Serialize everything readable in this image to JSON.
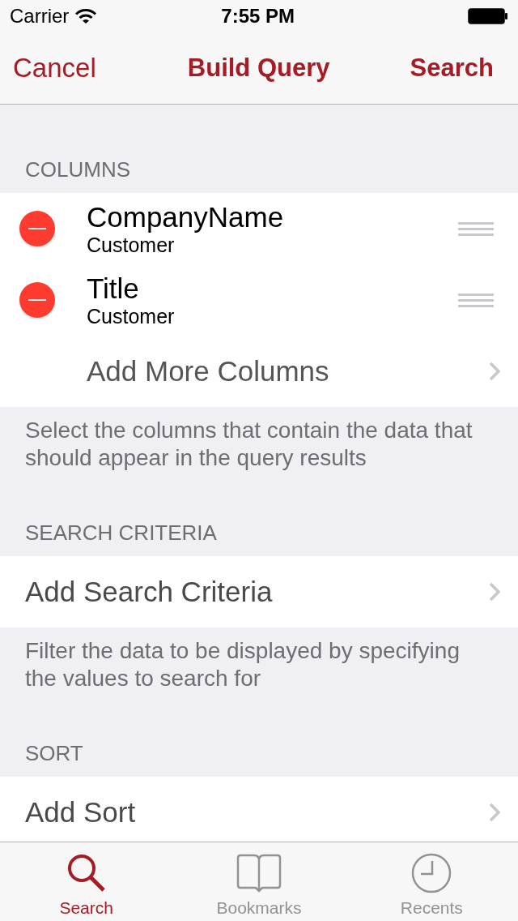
{
  "status_bar": {
    "carrier": "Carrier",
    "time": "7:55 PM"
  },
  "nav_bar": {
    "left_button": "Cancel",
    "title": "Build Query",
    "right_button": "Search"
  },
  "sections": [
    {
      "header": "COLUMNS",
      "rows": [
        {
          "kind": "column",
          "title": "CompanyName",
          "subtitle": "Customer"
        },
        {
          "kind": "column",
          "title": "Title",
          "subtitle": "Customer"
        },
        {
          "kind": "add",
          "label": "Add More Columns"
        }
      ],
      "footer": "Select the columns that contain the data that should appear in the query results"
    },
    {
      "header": "SEARCH CRITERIA",
      "rows": [
        {
          "kind": "link",
          "label": "Add Search Criteria"
        }
      ],
      "footer": "Filter the data to be displayed by specifying the values to search for"
    },
    {
      "header": "SORT",
      "rows": [
        {
          "kind": "link",
          "label": "Add Sort"
        }
      ]
    }
  ],
  "tab_bar": [
    {
      "label": "Search",
      "selected": true
    },
    {
      "label": "Bookmarks",
      "selected": false
    },
    {
      "label": "Recents",
      "selected": false
    }
  ]
}
